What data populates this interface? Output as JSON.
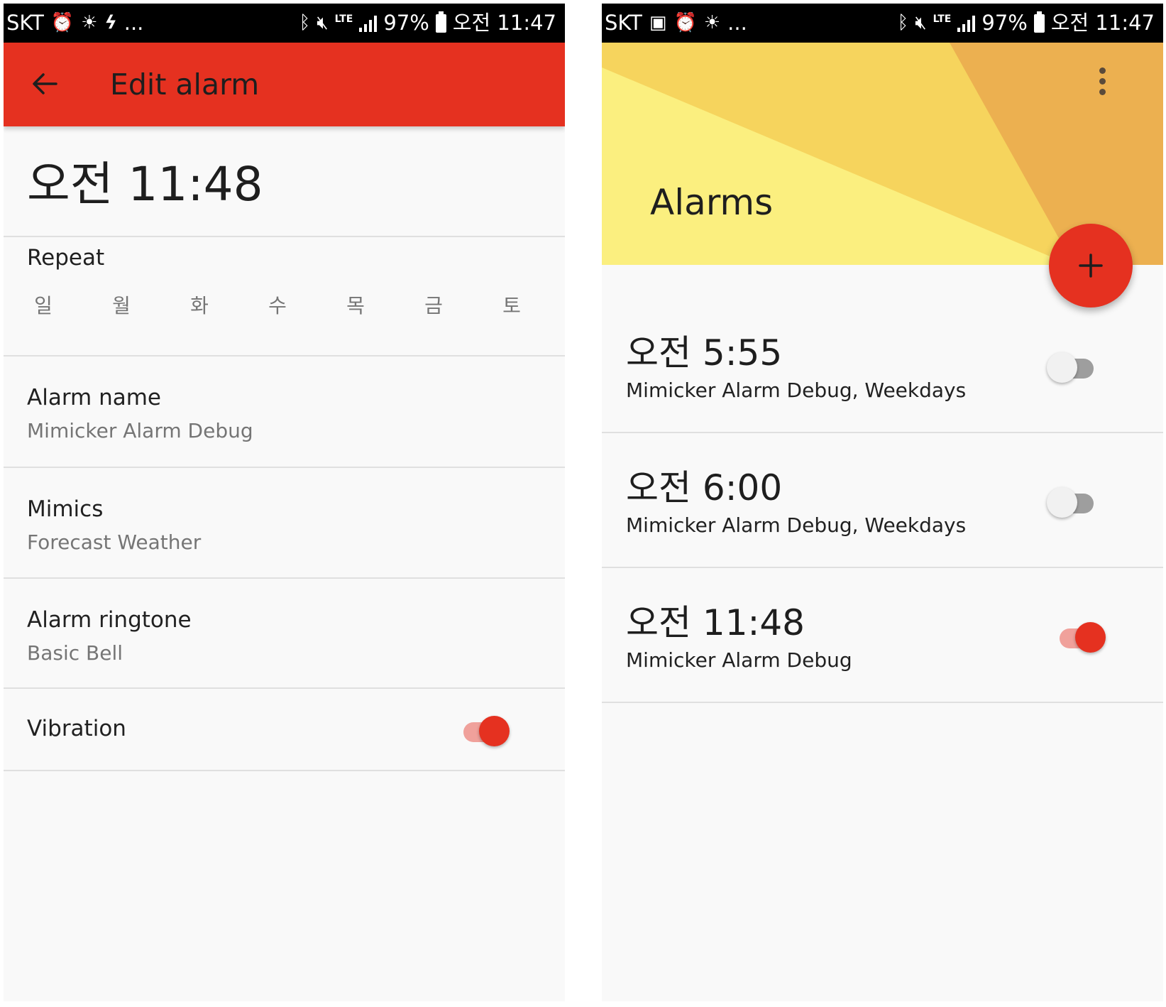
{
  "status_bar_left": {
    "carrier": "SKT",
    "icons": [
      "alarm-icon",
      "brightness-icon",
      "gallery-flash-icon",
      "more-icon"
    ],
    "more": "..."
  },
  "status_bar_right": {
    "carrier": "SKT",
    "icons": [
      "image-icon",
      "alarm-icon",
      "brightness-icon",
      "more-icon"
    ],
    "more": "..."
  },
  "status_common": {
    "network": "LTE",
    "battery": "97%",
    "time": "오전 11:47"
  },
  "edit_screen": {
    "title": "Edit alarm",
    "alarm_time": "오전 11:48",
    "repeat_label": "Repeat",
    "days": [
      "일",
      "월",
      "화",
      "수",
      "목",
      "금",
      "토"
    ],
    "settings": [
      {
        "title": "Alarm name",
        "value": "Mimicker Alarm Debug"
      },
      {
        "title": "Mimics",
        "value": "Forecast Weather"
      },
      {
        "title": "Alarm ringtone",
        "value": "Basic Bell"
      }
    ],
    "vibration_label": "Vibration",
    "vibration_on": true
  },
  "alarms_screen": {
    "title": "Alarms",
    "fab_label": "+",
    "alarms": [
      {
        "time": "오전 5:55",
        "description": "Mimicker Alarm Debug, Weekdays",
        "enabled": false
      },
      {
        "time": "오전 6:00",
        "description": "Mimicker Alarm Debug, Weekdays",
        "enabled": false
      },
      {
        "time": "오전 11:48",
        "description": "Mimicker Alarm Debug",
        "enabled": true
      }
    ]
  },
  "colors": {
    "accent": "#e53120",
    "header_light": "#fbef7f",
    "header_mid": "#f6d45d",
    "header_dark": "#ecb050",
    "background": "#f9f9f9",
    "divider": "#e0e0e0"
  }
}
